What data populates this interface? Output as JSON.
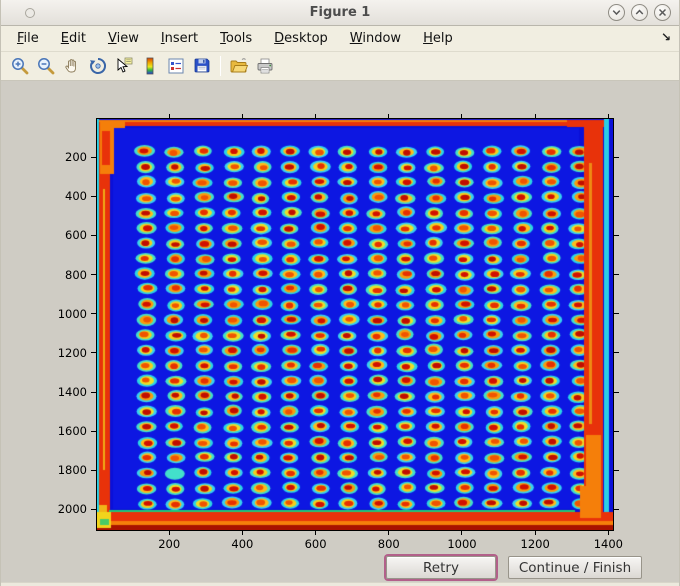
{
  "window": {
    "title": "Figure 1",
    "controls": [
      "minimize",
      "maximize",
      "close"
    ]
  },
  "menu": {
    "items": [
      "File",
      "Edit",
      "View",
      "Insert",
      "Tools",
      "Desktop",
      "Window",
      "Help"
    ],
    "dock_arrow": "↘"
  },
  "toolbar": {
    "items": [
      "zoom-in",
      "zoom-out",
      "pan",
      "rotate-3d",
      "data-cursor",
      "insert-colorbar",
      "insert-legend",
      "save-figure",
      "open-file",
      "print-figure"
    ]
  },
  "buttons": {
    "retry": "Retry",
    "continue_finish": "Continue / Finish"
  },
  "chart_data": {
    "type": "heatmap",
    "title": "",
    "xlabel": "",
    "ylabel": "",
    "x_range": [
      0,
      1410
    ],
    "y_range": [
      0,
      2110
    ],
    "x_ticks": [
      200,
      400,
      600,
      800,
      1000,
      1200,
      1400
    ],
    "y_ticks": [
      200,
      400,
      600,
      800,
      1000,
      1200,
      1400,
      1600,
      1800,
      2000
    ],
    "y_axis_direction": "down",
    "grid": {
      "cols": 16,
      "rows": 24,
      "x_start": 134,
      "x_pitch": 79,
      "y_start": 168,
      "y_pitch": 78.5,
      "anomaly_spot": {
        "row": 21,
        "col": 1
      }
    },
    "colors": {
      "background_blue": "#0b10d8",
      "plate_blue": "#0d17e2",
      "border_red": "#e8320a",
      "border_orange": "#f57f0a",
      "dark_red": "#a81200",
      "yellow": "#f2d41c",
      "green": "#1ec878",
      "edge_cyan": "#29cfe4",
      "spot_halo": [
        "#2bd5e6",
        "#43e0cb",
        "#38d2f0"
      ],
      "spot_ring": [
        "#f4cf1d",
        "#f79d0e",
        "#fdbd1c",
        "#ecdf2a"
      ],
      "spot_core": [
        "#e63000",
        "#d11000",
        "#f05400",
        "#c00d00"
      ]
    },
    "description": "Jet-colormap image of a microtiter plate / microarray scan: a 16 x 24 grid of warm red-orange spots with cyan halos on a deep blue background, with saturated red and orange bands along the plate edges."
  }
}
